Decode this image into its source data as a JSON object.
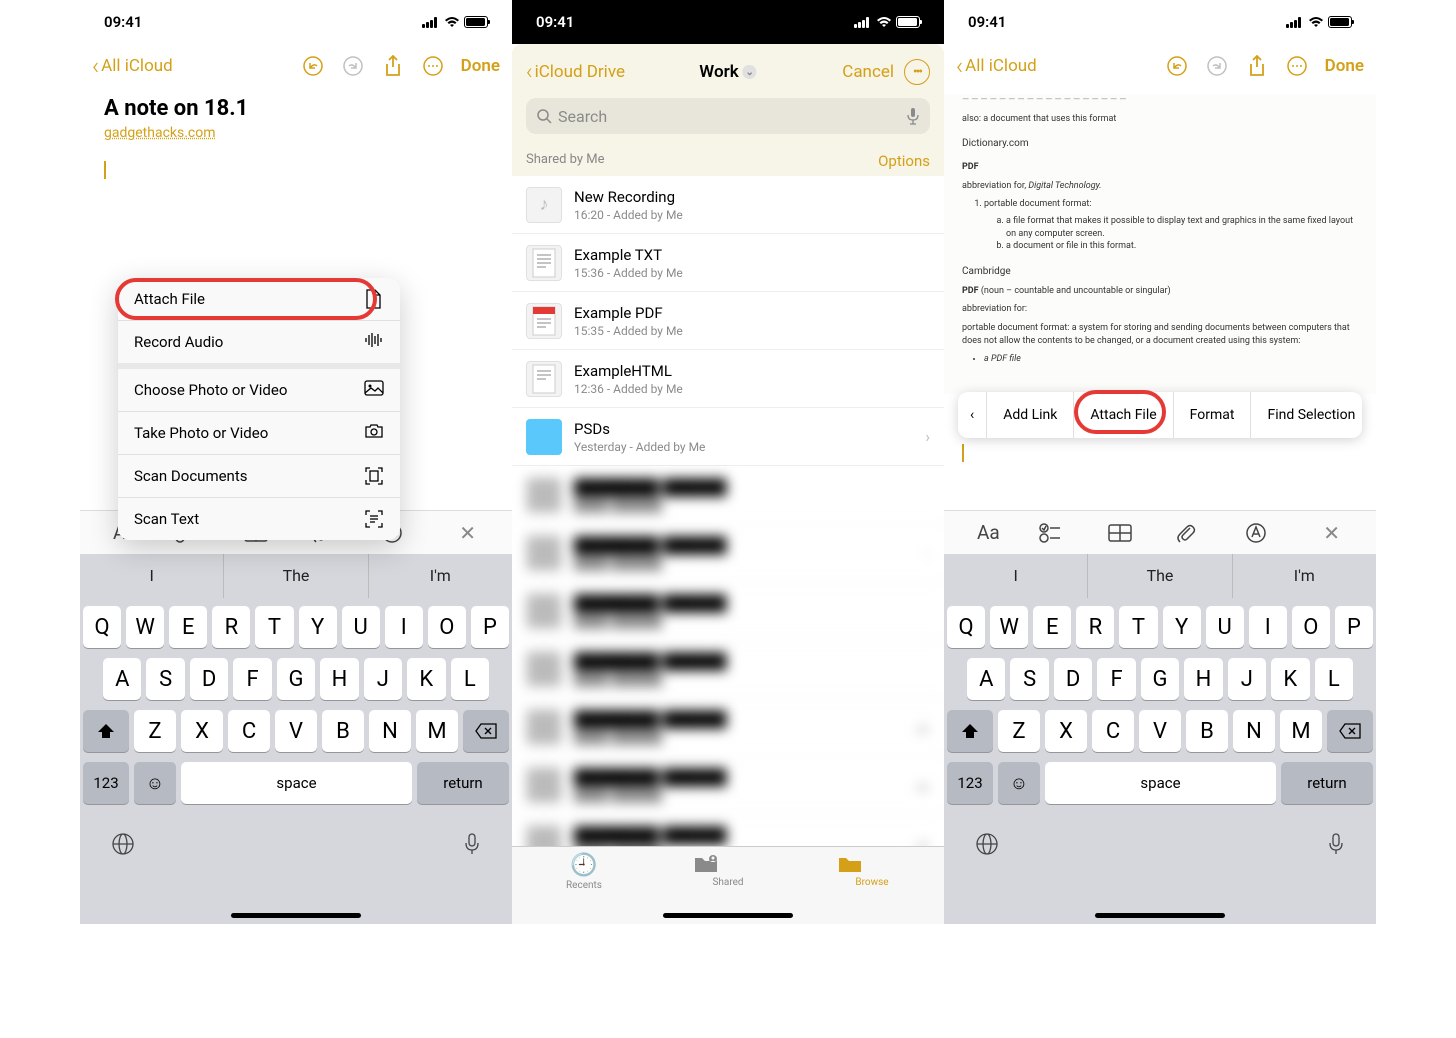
{
  "status": {
    "time": "09:41"
  },
  "s1": {
    "nav": {
      "back": "All iCloud",
      "done": "Done"
    },
    "note": {
      "title": "A note on 18.1",
      "link": "gadgethacks.com"
    },
    "menu": [
      {
        "label": "Attach File",
        "icon": "file-icon",
        "highlight": true,
        "sep": false
      },
      {
        "label": "Record Audio",
        "icon": "waveform-icon",
        "sep": true
      },
      {
        "label": "Choose Photo or Video",
        "icon": "photo-icon",
        "sep": false
      },
      {
        "label": "Take Photo or Video",
        "icon": "camera-icon",
        "sep": false
      },
      {
        "label": "Scan Documents",
        "icon": "scan-doc-icon",
        "sep": false
      },
      {
        "label": "Scan Text",
        "icon": "scan-text-icon",
        "sep": false
      }
    ]
  },
  "s2": {
    "nav": {
      "back": "iCloud Drive",
      "title": "Work",
      "cancel": "Cancel"
    },
    "search": {
      "placeholder": "Search"
    },
    "section": {
      "header": "Shared by Me",
      "options": "Options"
    },
    "files": [
      {
        "name": "New Recording",
        "meta": "16:20 - Added by Me",
        "kind": "audio"
      },
      {
        "name": "Example TXT",
        "meta": "15:36 - Added by Me",
        "kind": "txt"
      },
      {
        "name": "Example PDF",
        "meta": "15:35 - Added by Me",
        "kind": "pdf"
      },
      {
        "name": "ExampleHTML",
        "meta": "12:36 - Added by Me",
        "kind": "html"
      },
      {
        "name": "PSDs",
        "meta": "Yesterday - Added by Me",
        "kind": "folder",
        "chevron": true
      }
    ],
    "tabs": {
      "recents": "Recents",
      "shared": "Shared",
      "browse": "Browse"
    }
  },
  "s3": {
    "nav": {
      "back": "All iCloud",
      "done": "Done"
    },
    "doc": {
      "line_also": "also: a document that uses this format",
      "src_dict": "Dictionary.com",
      "pdf_label": "PDF",
      "abbrev_for": "abbreviation for, ",
      "abbrev_em": "Digital Technology.",
      "li1": "portable document format:",
      "li1a": "a file format that makes it possible to display text and graphics in the same fixed layout on any computer screen.",
      "li1b": "a document or file in this format.",
      "src_camb": "Cambridge",
      "pdf2": "PDF",
      "pdf2_aside": "(noun – countable and uncountable or singular)",
      "abbrev2": "abbreviation for:",
      "para_camb": "portable document format: a system for storing and sending documents between computers that does not allow the contents to be changed, or a document created using this system:",
      "bullet": "a PDF file"
    },
    "context": [
      {
        "label": "‹",
        "name": "context-prev"
      },
      {
        "label": "Add Link",
        "name": "context-add-link"
      },
      {
        "label": "Attach File",
        "name": "context-attach-file",
        "highlight": true
      },
      {
        "label": "Format",
        "name": "context-format"
      },
      {
        "label": "Find Selection",
        "name": "context-find-selection"
      }
    ]
  },
  "keyboard": {
    "suggestions": [
      "I",
      "The",
      "I'm"
    ],
    "row1": [
      "Q",
      "W",
      "E",
      "R",
      "T",
      "Y",
      "U",
      "I",
      "O",
      "P"
    ],
    "row2": [
      "A",
      "S",
      "D",
      "F",
      "G",
      "H",
      "J",
      "K",
      "L"
    ],
    "row3": [
      "Z",
      "X",
      "C",
      "V",
      "B",
      "N",
      "M"
    ],
    "num": "123",
    "space": "space",
    "ret": "return"
  }
}
